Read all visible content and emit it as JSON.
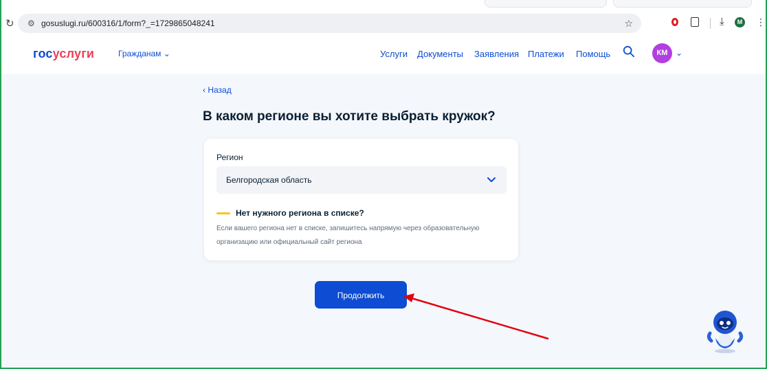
{
  "browser": {
    "url": "gosuslugi.ru/600316/1/form?_=1729865048241",
    "profile_initial": "M"
  },
  "header": {
    "logo_part1": "гос",
    "logo_part2": "услуги",
    "citizens_label": "Гражданам",
    "nav": [
      "Услуги",
      "Документы",
      "Заявления",
      "Платежи",
      "Помощь"
    ],
    "avatar_initials": "КМ"
  },
  "main": {
    "back_label": "‹ Назад",
    "title": "В каком регионе вы хотите выбрать кружок?",
    "region_label": "Регион",
    "region_value": "Белгородская область",
    "hint_title": "Нет нужного региона в списке?",
    "hint_text": "Если вашего региона нет в списке, запишитесь напрямую через образовательную организацию или официальный сайт региона",
    "continue_label": "Продолжить"
  },
  "colors": {
    "brand_blue": "#0d4cd3",
    "brand_red": "#ee3f58",
    "avatar": "#b23fe0",
    "accent_yellow": "#f7c325",
    "annotation_arrow": "#e3000f"
  }
}
